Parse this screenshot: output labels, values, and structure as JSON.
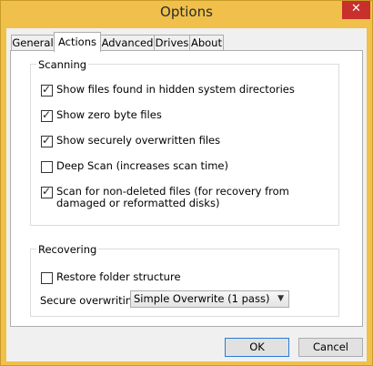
{
  "window": {
    "title": "Options",
    "close_icon": "close-icon"
  },
  "tabs": [
    {
      "label": "General"
    },
    {
      "label": "Actions",
      "active": true
    },
    {
      "label": "Advanced"
    },
    {
      "label": "Drives"
    },
    {
      "label": "About"
    }
  ],
  "scanning": {
    "title": "Scanning",
    "options": [
      {
        "label": "Show files found in hidden system directories",
        "checked": true
      },
      {
        "label": "Show zero byte files",
        "checked": true
      },
      {
        "label": "Show securely overwritten files",
        "checked": true
      },
      {
        "label": "Deep Scan (increases scan time)",
        "checked": false
      },
      {
        "label": "Scan for non-deleted files (for recovery from damaged or reformatted disks)",
        "checked": true
      }
    ]
  },
  "recovering": {
    "title": "Recovering",
    "restore_label": "Restore folder structure",
    "restore_checked": false,
    "secure_label": "Secure overwriting",
    "secure_value": "Simple Overwrite (1 pass)"
  },
  "buttons": {
    "ok": "OK",
    "cancel": "Cancel"
  }
}
